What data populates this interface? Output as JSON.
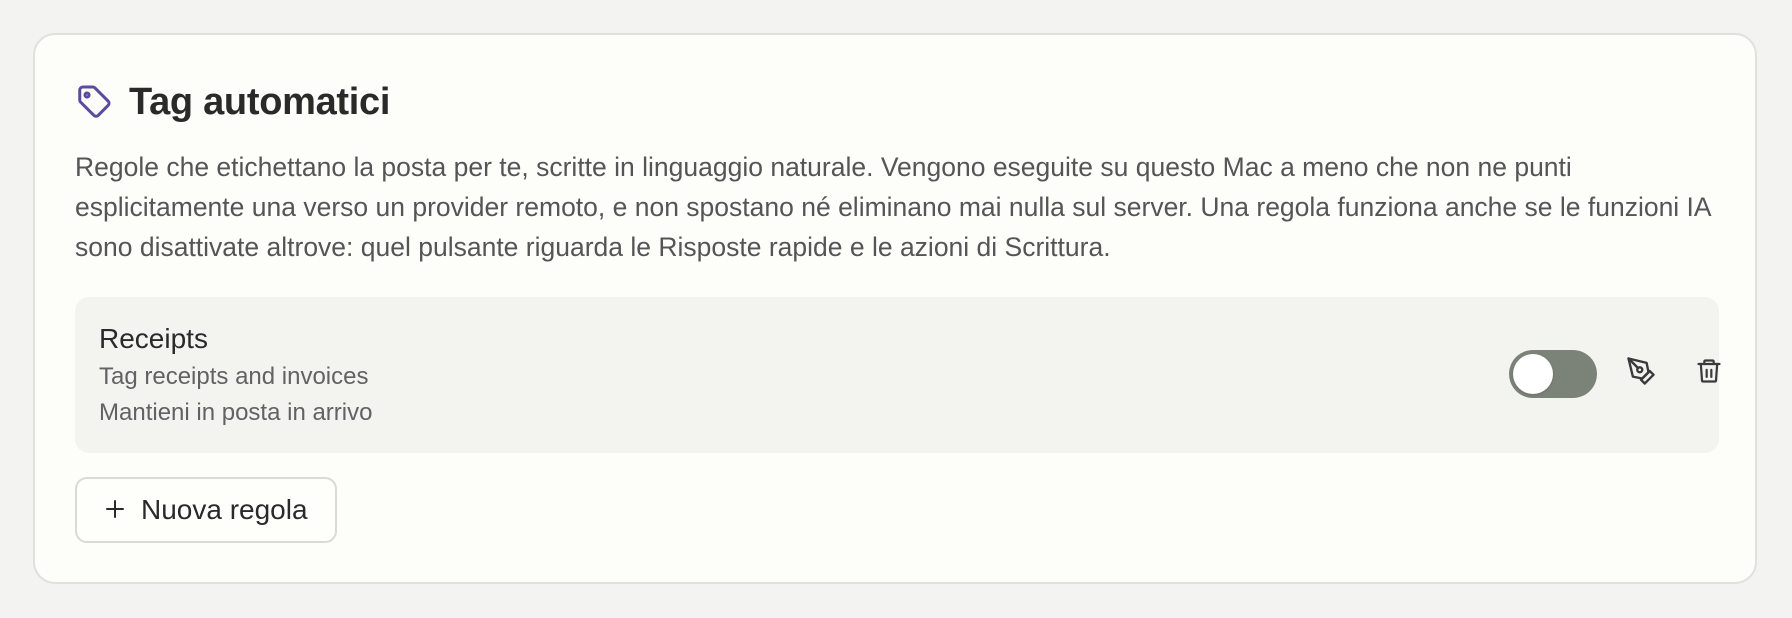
{
  "section": {
    "title": "Tag automatici",
    "icon": "tag-icon",
    "accent_color": "#5b4a9e",
    "description": "Regole che etichettano la posta per te, scritte in linguaggio naturale. Vengono eseguite su questo Mac a meno che non ne punti esplicitamente una verso un provider remoto, e non spostano né eliminano mai nulla sul server. Una regola funziona anche se le funzioni IA sono disattivate altrove: quel pulsante riguarda le Risposte rapide e le azioni di Scrittura."
  },
  "rules": [
    {
      "name": "Receipts",
      "description": "Tag receipts and invoices",
      "action": "Mantieni in posta in arrivo",
      "enabled": false,
      "edit_icon": "pen-icon",
      "delete_icon": "trash-icon"
    }
  ],
  "new_rule_button": {
    "icon": "plus-icon",
    "label": "Nuova regola"
  }
}
